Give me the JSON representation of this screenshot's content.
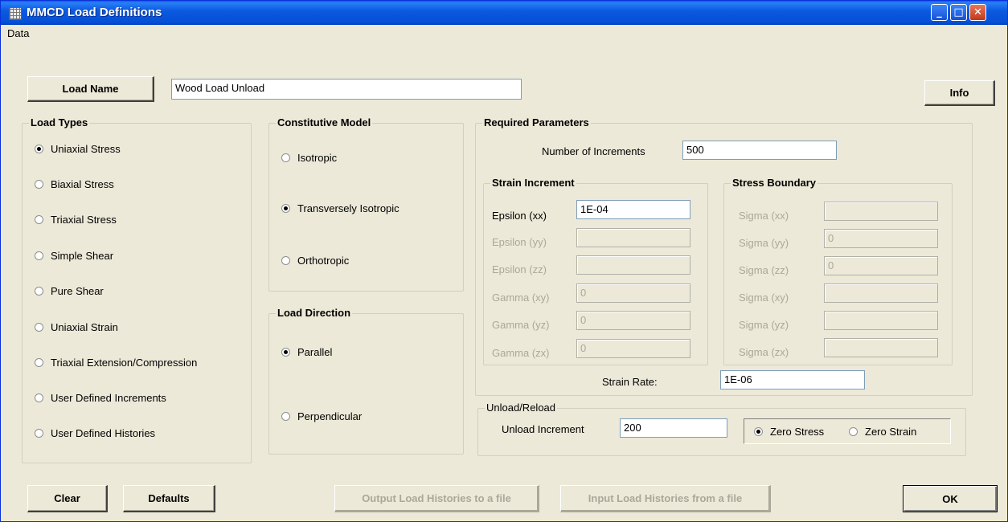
{
  "window": {
    "title": "MMCD Load Definitions"
  },
  "menu": {
    "data": "Data"
  },
  "buttons": {
    "load_name": "Load Name",
    "info": "Info",
    "clear": "Clear",
    "defaults": "Defaults",
    "output_histories": "Output Load Histories to a file",
    "input_histories": "Input Load Histories from a file",
    "ok": "OK"
  },
  "load_name_value": "Wood Load Unload",
  "load_types": {
    "title": "Load Types",
    "options": [
      "Uniaxial Stress",
      "Biaxial Stress",
      "Triaxial Stress",
      "Simple Shear",
      "Pure Shear",
      "Uniaxial Strain",
      "Triaxial Extension/Compression",
      "User Defined Increments",
      "User Defined Histories"
    ],
    "selected": "Uniaxial Stress"
  },
  "constitutive_model": {
    "title": "Constitutive Model",
    "options": [
      "Isotropic",
      "Transversely Isotropic",
      "Orthotropic"
    ],
    "selected": "Transversely Isotropic"
  },
  "load_direction": {
    "title": "Load Direction",
    "options": [
      "Parallel",
      "Perpendicular"
    ],
    "selected": "Parallel"
  },
  "required_parameters": {
    "title": "Required Parameters",
    "num_increments_label": "Number of Increments",
    "num_increments_value": "500",
    "strain_increment": {
      "title": "Strain Increment",
      "labels": [
        "Epsilon (xx)",
        "Epsilon (yy)",
        "Epsilon (zz)",
        "Gamma (xy)",
        "Gamma (yz)",
        "Gamma (zx)"
      ],
      "values": [
        "1E-04",
        "",
        "",
        "0",
        "0",
        "0"
      ]
    },
    "stress_boundary": {
      "title": "Stress Boundary",
      "labels": [
        "Sigma (xx)",
        "Sigma (yy)",
        "Sigma (zz)",
        "Sigma (xy)",
        "Sigma (yz)",
        "Sigma (zx)"
      ],
      "values": [
        "",
        "0",
        "0",
        "",
        "",
        ""
      ]
    },
    "strain_rate_label": "Strain Rate:",
    "strain_rate_value": "1E-06"
  },
  "unload_reload": {
    "title": "Unload/Reload",
    "increment_label": "Unload Increment",
    "increment_value": "200",
    "options": [
      "Zero Stress",
      "Zero Strain"
    ],
    "selected": "Zero Stress"
  },
  "colors": {
    "titlebar": "#0550d6",
    "face": "#ece9d8",
    "disabled_text": "#aca899"
  }
}
